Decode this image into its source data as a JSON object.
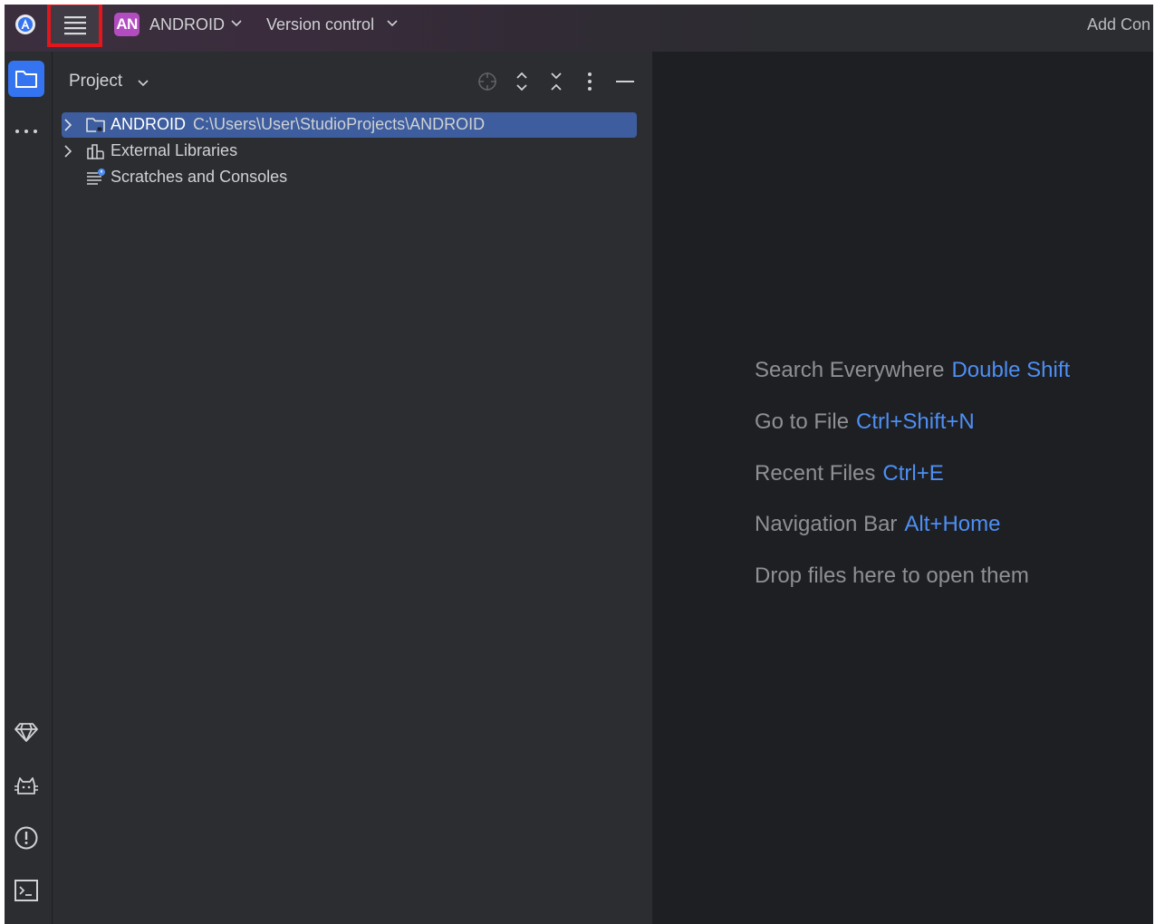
{
  "titlebar": {
    "project_badge": "AN",
    "project_name": "ANDROID",
    "vcs_label": "Version control",
    "add_config_label": "Add Con"
  },
  "project_panel": {
    "title": "Project",
    "tree": [
      {
        "name": "ANDROID",
        "path": "C:\\Users\\User\\StudioProjects\\ANDROID",
        "selected": true
      },
      {
        "name": "External Libraries",
        "path": "",
        "selected": false
      },
      {
        "name": "Scratches and Consoles",
        "path": "",
        "selected": false
      }
    ]
  },
  "editor": {
    "hints": [
      {
        "label": "Search Everywhere",
        "key": "Double Shift"
      },
      {
        "label": "Go to File",
        "key": "Ctrl+Shift+N"
      },
      {
        "label": "Recent Files",
        "key": "Ctrl+E"
      },
      {
        "label": "Navigation Bar",
        "key": "Alt+Home"
      },
      {
        "label": "Drop files here to open them",
        "key": ""
      }
    ]
  },
  "colors": {
    "accent": "#3574f0",
    "selection": "#3d5d9e",
    "shortcut": "#4d8ff5",
    "highlight_box": "#e3161c",
    "project_badge": "#b34cc0"
  },
  "icons": {
    "app_logo": "android-studio-logo-icon",
    "main_menu": "hamburger-menu-icon",
    "project_tool": "folder-icon",
    "more_tools": "more-horizontal-icon",
    "gemini": "diamond-icon",
    "app_inspection": "cat-icon",
    "problems": "warning-circle-icon",
    "terminal": "terminal-icon"
  }
}
